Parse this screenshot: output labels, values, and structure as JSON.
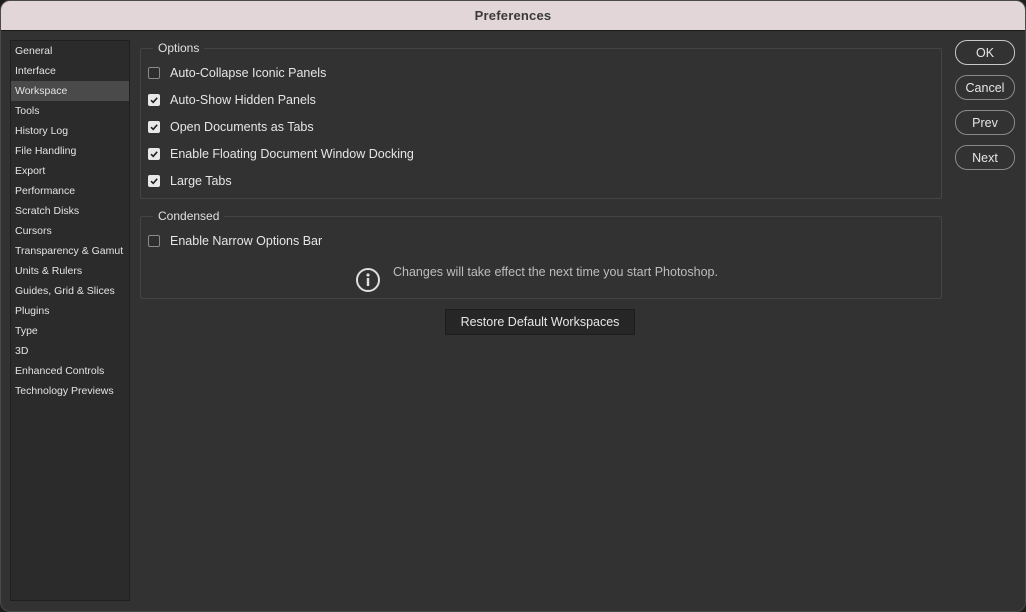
{
  "window": {
    "title": "Preferences"
  },
  "sidebar": {
    "items": [
      {
        "label": "General"
      },
      {
        "label": "Interface"
      },
      {
        "label": "Workspace",
        "active": true
      },
      {
        "label": "Tools"
      },
      {
        "label": "History Log"
      },
      {
        "label": "File Handling"
      },
      {
        "label": "Export"
      },
      {
        "label": "Performance"
      },
      {
        "label": "Scratch Disks"
      },
      {
        "label": "Cursors"
      },
      {
        "label": "Transparency & Gamut"
      },
      {
        "label": "Units & Rulers"
      },
      {
        "label": "Guides, Grid & Slices"
      },
      {
        "label": "Plugins"
      },
      {
        "label": "Type"
      },
      {
        "label": "3D"
      },
      {
        "label": "Enhanced Controls"
      },
      {
        "label": "Technology Previews"
      }
    ]
  },
  "options": {
    "legend": "Options",
    "items": [
      {
        "label": "Auto-Collapse Iconic Panels",
        "checked": false
      },
      {
        "label": "Auto-Show Hidden Panels",
        "checked": true
      },
      {
        "label": "Open Documents as Tabs",
        "checked": true
      },
      {
        "label": "Enable Floating Document Window Docking",
        "checked": true
      },
      {
        "label": "Large Tabs",
        "checked": true
      }
    ]
  },
  "condensed": {
    "legend": "Condensed",
    "items": [
      {
        "label": "Enable Narrow Options Bar",
        "checked": false
      }
    ],
    "info_icon": "info-circle-icon",
    "info_text": "Changes will take effect the next time you start Photoshop."
  },
  "restore_button": {
    "label": "Restore Default Workspaces"
  },
  "buttons": {
    "ok": "OK",
    "cancel": "Cancel",
    "prev": "Prev",
    "next": "Next"
  }
}
